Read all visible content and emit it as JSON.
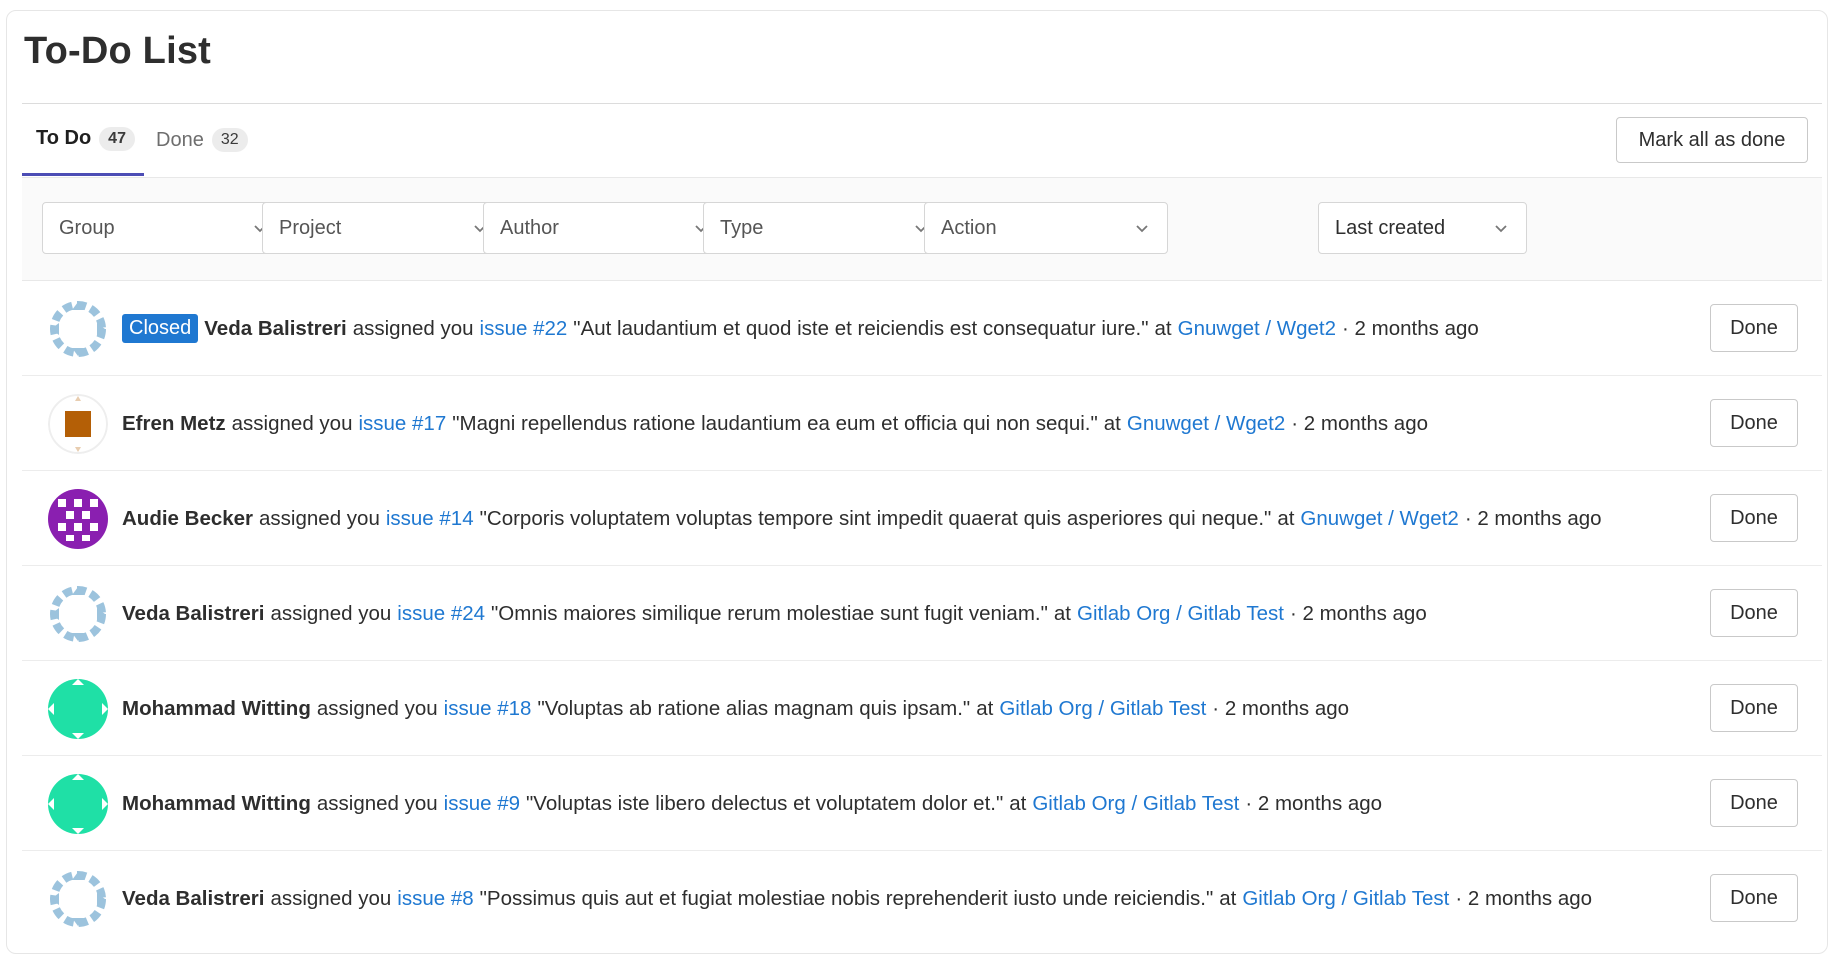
{
  "page": {
    "title": "To-Do List"
  },
  "tabs": [
    {
      "label": "To Do",
      "count": "47"
    },
    {
      "label": "Done",
      "count": "32"
    }
  ],
  "header": {
    "mark_all_label": "Mark all as done"
  },
  "filters": {
    "group": "Group",
    "project": "Project",
    "author": "Author",
    "type": "Type",
    "action": "Action",
    "sort": "Last created"
  },
  "colors": {
    "accent": "#1f78d1",
    "tab_underline": "#4c4db5",
    "closed_badge": "#1f78d1"
  },
  "todos": [
    {
      "avatar_icon": "identicon-blue-ring",
      "state": "Closed",
      "author": "Veda Balistreri",
      "action": "assigned you",
      "target": "issue #22",
      "title": "\"Aut laudantium et quod iste et reiciendis est consequatur iure.\"",
      "at": "at",
      "project": "Gnuwget / Wget2",
      "time": "· 2 months ago",
      "done_label": "Done"
    },
    {
      "avatar_icon": "identicon-brown-square",
      "state": "",
      "author": "Efren Metz",
      "action": "assigned you",
      "target": "issue #17",
      "title": "\"Magni repellendus ratione laudantium ea eum et officia qui non sequi.\"",
      "at": "at",
      "project": "Gnuwget / Wget2",
      "time": "· 2 months ago",
      "done_label": "Done"
    },
    {
      "avatar_icon": "identicon-purple-grid",
      "state": "",
      "author": "Audie Becker",
      "action": "assigned you",
      "target": "issue #14",
      "title": "\"Corporis voluptatem voluptas tempore sint impedit quaerat quis asperiores qui neque.\"",
      "at": "at",
      "project": "Gnuwget / Wget2",
      "time": "· 2 months ago",
      "done_label": "Done"
    },
    {
      "avatar_icon": "identicon-blue-ring",
      "state": "",
      "author": "Veda Balistreri",
      "action": "assigned you",
      "target": "issue #24",
      "title": "\"Omnis maiores similique rerum molestiae sunt fugit veniam.\"",
      "at": "at",
      "project": "Gitlab Org / Gitlab Test",
      "time": "· 2 months ago",
      "done_label": "Done"
    },
    {
      "avatar_icon": "identicon-green-blob",
      "state": "",
      "author": "Mohammad Witting",
      "action": "assigned you",
      "target": "issue #18",
      "title": "\"Voluptas ab ratione alias magnam quis ipsam.\"",
      "at": "at",
      "project": "Gitlab Org / Gitlab Test",
      "time": "· 2 months ago",
      "done_label": "Done"
    },
    {
      "avatar_icon": "identicon-green-blob",
      "state": "",
      "author": "Mohammad Witting",
      "action": "assigned you",
      "target": "issue #9",
      "title": "\"Voluptas iste libero delectus et voluptatem dolor et.\"",
      "at": "at",
      "project": "Gitlab Org / Gitlab Test",
      "time": "· 2 months ago",
      "done_label": "Done"
    },
    {
      "avatar_icon": "identicon-blue-ring",
      "state": "",
      "author": "Veda Balistreri",
      "action": "assigned you",
      "target": "issue #8",
      "title": "\"Possimus quis aut et fugiat molestiae nobis reprehenderit iusto unde reiciendis.\"",
      "at": "at",
      "project": "Gitlab Org / Gitlab Test",
      "time": "· 2 months ago",
      "done_label": "Done"
    }
  ]
}
